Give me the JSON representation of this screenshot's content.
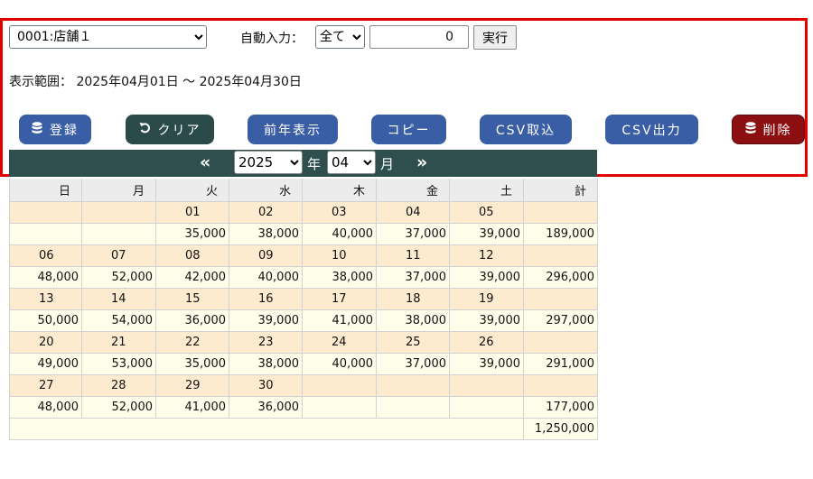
{
  "controls": {
    "store_select": {
      "value": "0001:店舗１",
      "options": [
        "0001:店舗１"
      ]
    },
    "auto_input_label": "自動入力：",
    "auto_select": {
      "value": "全て",
      "options": [
        "全て"
      ]
    },
    "auto_value": "0",
    "run_button": "実行",
    "range_label": "表示範囲： 2025年04月01日 ～ 2025年04月30日"
  },
  "buttons": {
    "register": "登録",
    "clear": "クリア",
    "prev_year": "前年表示",
    "copy": "コピー",
    "csv_import": "CSV取込",
    "csv_export": "CSV出力",
    "delete": "削除"
  },
  "colors": {
    "button_blue": "#3a5ea5",
    "button_dark": "#2b4a4a",
    "button_red": "#8b0f10",
    "nav_bar": "#2f4f4f",
    "highlight_frame": "#e00000"
  },
  "nav": {
    "prev_symbol": "«",
    "next_symbol": "»",
    "year": "2025",
    "year_unit": "年",
    "month": "04",
    "month_unit": "月"
  },
  "calendar": {
    "headers": [
      "日",
      "月",
      "火",
      "水",
      "木",
      "金",
      "土",
      "計"
    ],
    "weeks": [
      {
        "dates": [
          "",
          "",
          "01",
          "02",
          "03",
          "04",
          "05",
          ""
        ],
        "amounts": [
          "",
          "",
          "35,000",
          "38,000",
          "40,000",
          "37,000",
          "39,000",
          "189,000"
        ]
      },
      {
        "dates": [
          "06",
          "07",
          "08",
          "09",
          "10",
          "11",
          "12",
          ""
        ],
        "amounts": [
          "48,000",
          "52,000",
          "42,000",
          "40,000",
          "38,000",
          "37,000",
          "39,000",
          "296,000"
        ]
      },
      {
        "dates": [
          "13",
          "14",
          "15",
          "16",
          "17",
          "18",
          "19",
          ""
        ],
        "amounts": [
          "50,000",
          "54,000",
          "36,000",
          "39,000",
          "41,000",
          "38,000",
          "39,000",
          "297,000"
        ]
      },
      {
        "dates": [
          "20",
          "21",
          "22",
          "23",
          "24",
          "25",
          "26",
          ""
        ],
        "amounts": [
          "49,000",
          "53,000",
          "35,000",
          "38,000",
          "40,000",
          "37,000",
          "39,000",
          "291,000"
        ]
      },
      {
        "dates": [
          "27",
          "28",
          "29",
          "30",
          "",
          "",
          "",
          ""
        ],
        "amounts": [
          "48,000",
          "52,000",
          "41,000",
          "36,000",
          "",
          "",
          "",
          "177,000"
        ]
      }
    ],
    "grand_total": "1,250,000"
  }
}
